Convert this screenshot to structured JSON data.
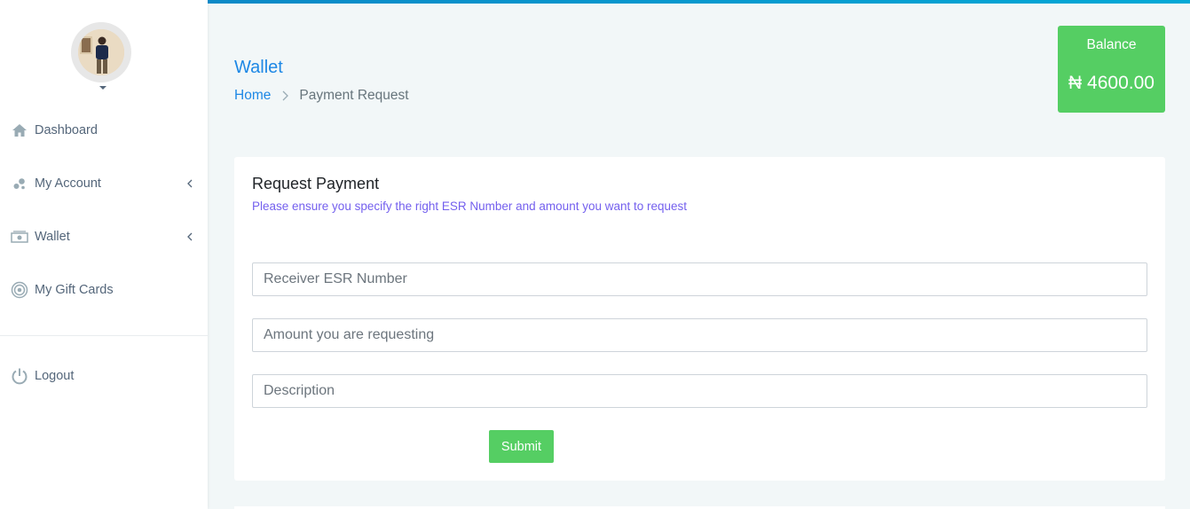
{
  "sidebar": {
    "items": [
      {
        "label": "Dashboard",
        "icon": "home-icon",
        "has_submenu": false
      },
      {
        "label": "My Account",
        "icon": "bubbles-icon",
        "has_submenu": true
      },
      {
        "label": "Wallet",
        "icon": "money-icon",
        "has_submenu": true
      },
      {
        "label": "My Gift Cards",
        "icon": "target-icon",
        "has_submenu": false
      }
    ],
    "logout": {
      "label": "Logout",
      "icon": "power-icon"
    }
  },
  "header": {
    "title": "Wallet",
    "breadcrumb": {
      "home": "Home",
      "current": "Payment Request"
    }
  },
  "balance": {
    "label": "Balance",
    "value": "₦ 4600.00"
  },
  "form": {
    "title": "Request Payment",
    "subtitle": "Please ensure you specify the right ESR Number and amount you want to request",
    "receiver_placeholder": "Receiver ESR Number",
    "amount_placeholder": "Amount you are requesting",
    "description_placeholder": "Description",
    "submit_label": "Submit"
  },
  "colors": {
    "accent": "#1e88e5",
    "success": "#55ce63",
    "subtitle": "#7460ee"
  }
}
